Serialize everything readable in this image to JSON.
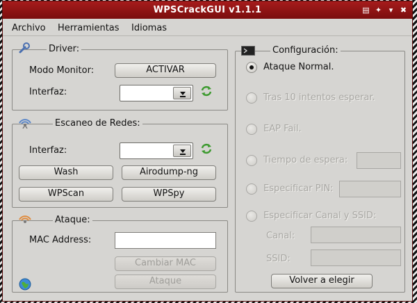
{
  "window": {
    "title": "WPSCrackGUI v1.1.1"
  },
  "menu": {
    "items": [
      "Archivo",
      "Herramientas",
      "Idiomas"
    ]
  },
  "driver": {
    "title": "Driver:",
    "monitor_label": "Modo Monitor:",
    "activate_button": "ACTIVAR",
    "interface_label": "Interfaz:",
    "interface_value": ""
  },
  "scan": {
    "title": "Escaneo de Redes:",
    "interface_label": "Interfaz:",
    "interface_value": "",
    "buttons": [
      "Wash",
      "Airodump-ng",
      "WPScan",
      "WPSpy"
    ]
  },
  "attack": {
    "title": "Ataque:",
    "mac_label": "MAC Address:",
    "mac_value": "",
    "change_mac_button": "Cambiar MAC",
    "attack_button": "Ataque"
  },
  "config": {
    "title": "Configuración:",
    "options": [
      {
        "label": "Ataque Normal.",
        "selected": true,
        "enabled": true
      },
      {
        "label": "Tras 10 intentos esperar.",
        "selected": false,
        "enabled": false
      },
      {
        "label": "EAP Fail.",
        "selected": false,
        "enabled": false
      },
      {
        "label": "Tiempo de espera:",
        "selected": false,
        "enabled": false
      },
      {
        "label": "Especificar PIN:",
        "selected": false,
        "enabled": false
      },
      {
        "label": "Especificar Canal y SSID:",
        "selected": false,
        "enabled": false
      }
    ],
    "channel_label": "Canal:",
    "ssid_label": "SSID:",
    "back_button": "Volver a elegir"
  },
  "colors": {
    "titlebar": "#8f1414",
    "window_bg": "#d6d5d2",
    "disabled_text": "#a9a8a4"
  }
}
